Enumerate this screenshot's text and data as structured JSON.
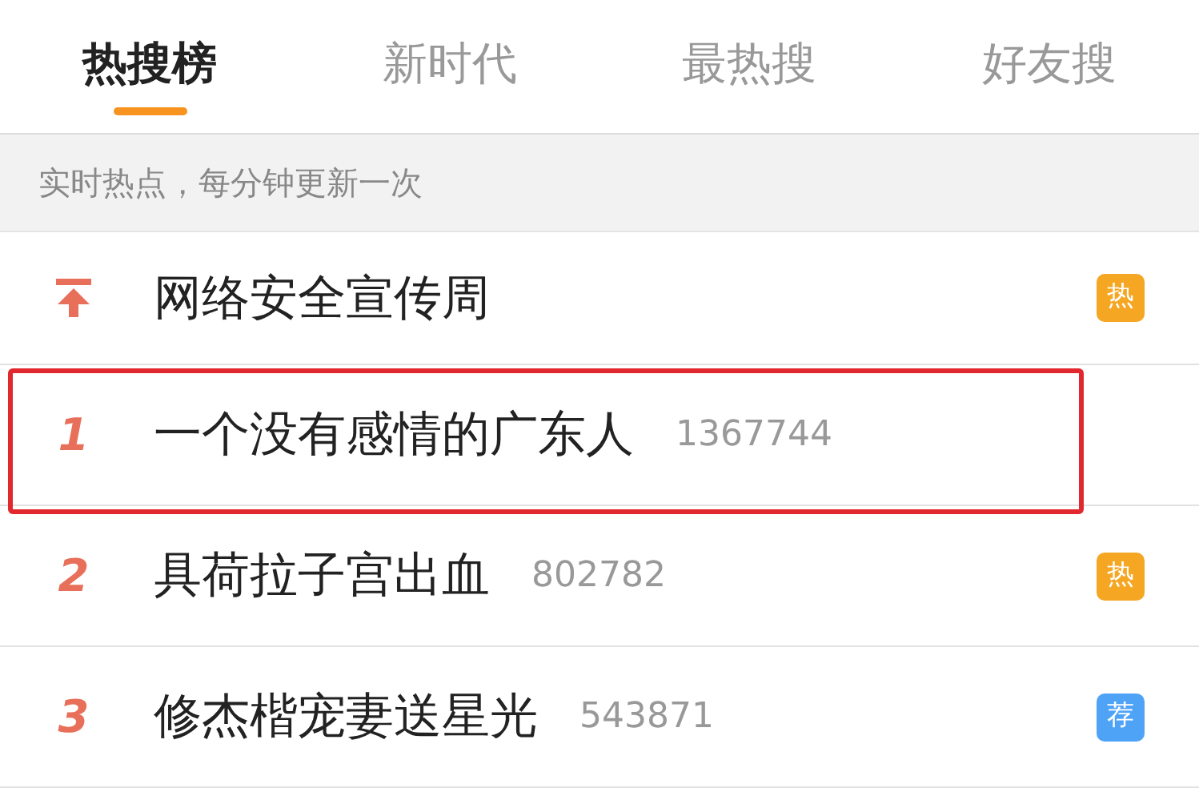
{
  "tabs": [
    {
      "label": "热搜榜",
      "selected": true
    },
    {
      "label": "新时代",
      "selected": false
    },
    {
      "label": "最热搜",
      "selected": false
    },
    {
      "label": "好友搜",
      "selected": false
    }
  ],
  "subheader": "实时热点，每分钟更新一次",
  "rows": [
    {
      "kind": "pinned",
      "title": "网络安全宣传周",
      "badge": {
        "text": "热",
        "color": "#f5a623"
      },
      "highlighted": false
    },
    {
      "kind": "ranked",
      "rank": "1",
      "title": "一个没有感情的广东人",
      "count": "1367744",
      "highlighted": true
    },
    {
      "kind": "ranked",
      "rank": "2",
      "title": "具荷拉子宫出血",
      "count": "802782",
      "badge": {
        "text": "热",
        "color": "#f5a623"
      },
      "highlighted": false
    },
    {
      "kind": "ranked",
      "rank": "3",
      "title": "修杰楷宠妻送星光",
      "count": "543871",
      "badge": {
        "text": "荐",
        "color": "#4fa3f7"
      },
      "highlighted": false
    }
  ]
}
